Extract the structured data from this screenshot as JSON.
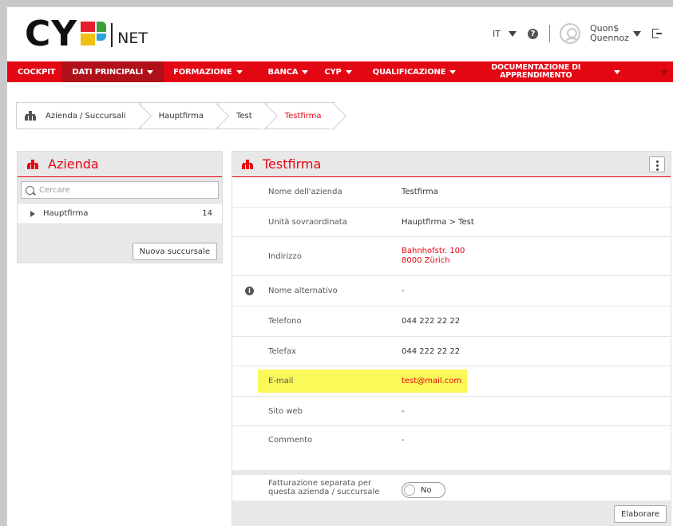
{
  "header": {
    "logo_letters": "CY",
    "logo_suffix": "NET",
    "language": "IT",
    "help_symbol": "?",
    "user_first": "Quon$",
    "user_last": "Quennoz",
    "icons": [
      "chevron-down-icon",
      "help-icon",
      "avatar-icon",
      "logout-icon"
    ]
  },
  "nav": {
    "items": [
      {
        "label": "COCKPIT"
      },
      {
        "label": "DATI PRINCIPALI"
      },
      {
        "label": "FORMAZIONE"
      },
      {
        "label": "BANCA"
      },
      {
        "label": "CYP"
      },
      {
        "label": "QUALIFICAZIONE"
      },
      {
        "label_line1": "DOCUMENTAZIONE DI",
        "label_line2": "APPRENDIMENTO"
      }
    ],
    "star": "★"
  },
  "breadcrumb": [
    "Azienda / Succursali",
    "Hauptfirma",
    "Test",
    "Testfirma"
  ],
  "left_panel": {
    "title": "Azienda",
    "search_placeholder": "Cercare",
    "tree": [
      {
        "label": "Hauptfirma",
        "count": "14"
      }
    ],
    "new_button": "Nuova succursale"
  },
  "right_panel": {
    "title": "Testfirma",
    "fields": [
      {
        "label": "Nome dell'azienda",
        "value": "Testfirma"
      },
      {
        "label": "Unità sovraordinata",
        "value": "Hauptfirma > Test"
      },
      {
        "label": "Indirizzo",
        "value_line1": "Bahnhofstr. 100",
        "value_line2": "8000 Zürich"
      },
      {
        "label": "Nome alternativo",
        "value": "-"
      },
      {
        "label": "Telefono",
        "value": "044 222 22 22"
      },
      {
        "label": "Telefax",
        "value": "044 222 22 22"
      },
      {
        "label": "E-mail",
        "value": "test@mail.com"
      },
      {
        "label": "Sito web",
        "value": "-"
      },
      {
        "label": "Commento",
        "value": "-"
      }
    ],
    "billing": {
      "label_line1": "Fatturazione separata per",
      "label_line2": "questa azienda / succursale",
      "toggle": "No"
    },
    "edit_button": "Elaborare",
    "info_symbol": "i"
  },
  "colors": {
    "accent": "#e30613",
    "highlight": "#fbf859",
    "panel_bg": "#e8e8e8"
  }
}
